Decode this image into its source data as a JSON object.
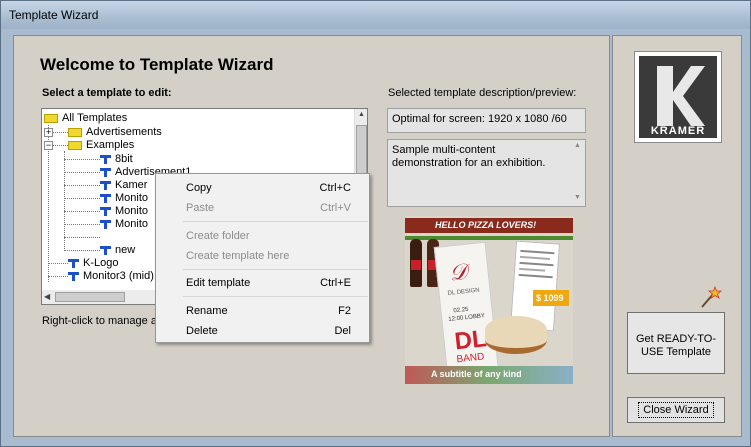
{
  "window": {
    "title": "Template Wizard"
  },
  "main": {
    "heading": "Welcome to Template Wizard",
    "select_label": "Select a template to edit:",
    "right_click_hint": "Right-click to manage a fo",
    "description_label": "Selected template description/preview:",
    "optimal_text": "Optimal for screen: 1920 x 1080 /60",
    "description_text": "Sample multi-content demonstration for an exhibition."
  },
  "tree": {
    "items": [
      {
        "label": "All Templates",
        "type": "folder"
      },
      {
        "label": "Advertisements",
        "type": "folder"
      },
      {
        "label": "Examples",
        "type": "folder"
      },
      {
        "label": "8bit",
        "type": "template"
      },
      {
        "label": "Advertisement1",
        "type": "template"
      },
      {
        "label": "Kamer",
        "type": "template"
      },
      {
        "label": "Monito",
        "type": "template"
      },
      {
        "label": "Monito",
        "type": "template"
      },
      {
        "label": "Monito",
        "type": "template"
      },
      {
        "label": "new",
        "type": "template"
      },
      {
        "label": "K-Logo",
        "type": "template"
      },
      {
        "label": "Monitor3 (mid)",
        "type": "template"
      }
    ]
  },
  "context_menu": {
    "copy": {
      "label": "Copy",
      "shortcut": "Ctrl+C"
    },
    "paste": {
      "label": "Paste",
      "shortcut": "Ctrl+V"
    },
    "create_folder": {
      "label": "Create folder"
    },
    "create_template": {
      "label": "Create template here"
    },
    "edit_template": {
      "label": "Edit template",
      "shortcut": "Ctrl+E"
    },
    "rename": {
      "label": "Rename",
      "shortcut": "F2"
    },
    "delete": {
      "label": "Delete",
      "shortcut": "Del"
    }
  },
  "preview": {
    "banner": "HELLO PIZZA LOVERS!",
    "price": "$ 1099",
    "dl_text": "DL",
    "band_text": "BAND",
    "subtitle": "A subtitle of any kind",
    "date_text": "02.25",
    "time_text": "12:00 LOBBY",
    "card_text": "DL DESIGN"
  },
  "sidebar": {
    "logo_text": "KRAMER",
    "get_button": "Get READY-TO-USE Template",
    "close_button": "Close Wizard"
  },
  "colors": {
    "accent": "#1c4fc8",
    "folder": "#f0d830",
    "frame": "#a9bccf",
    "dialog": "#d4d0c8"
  }
}
